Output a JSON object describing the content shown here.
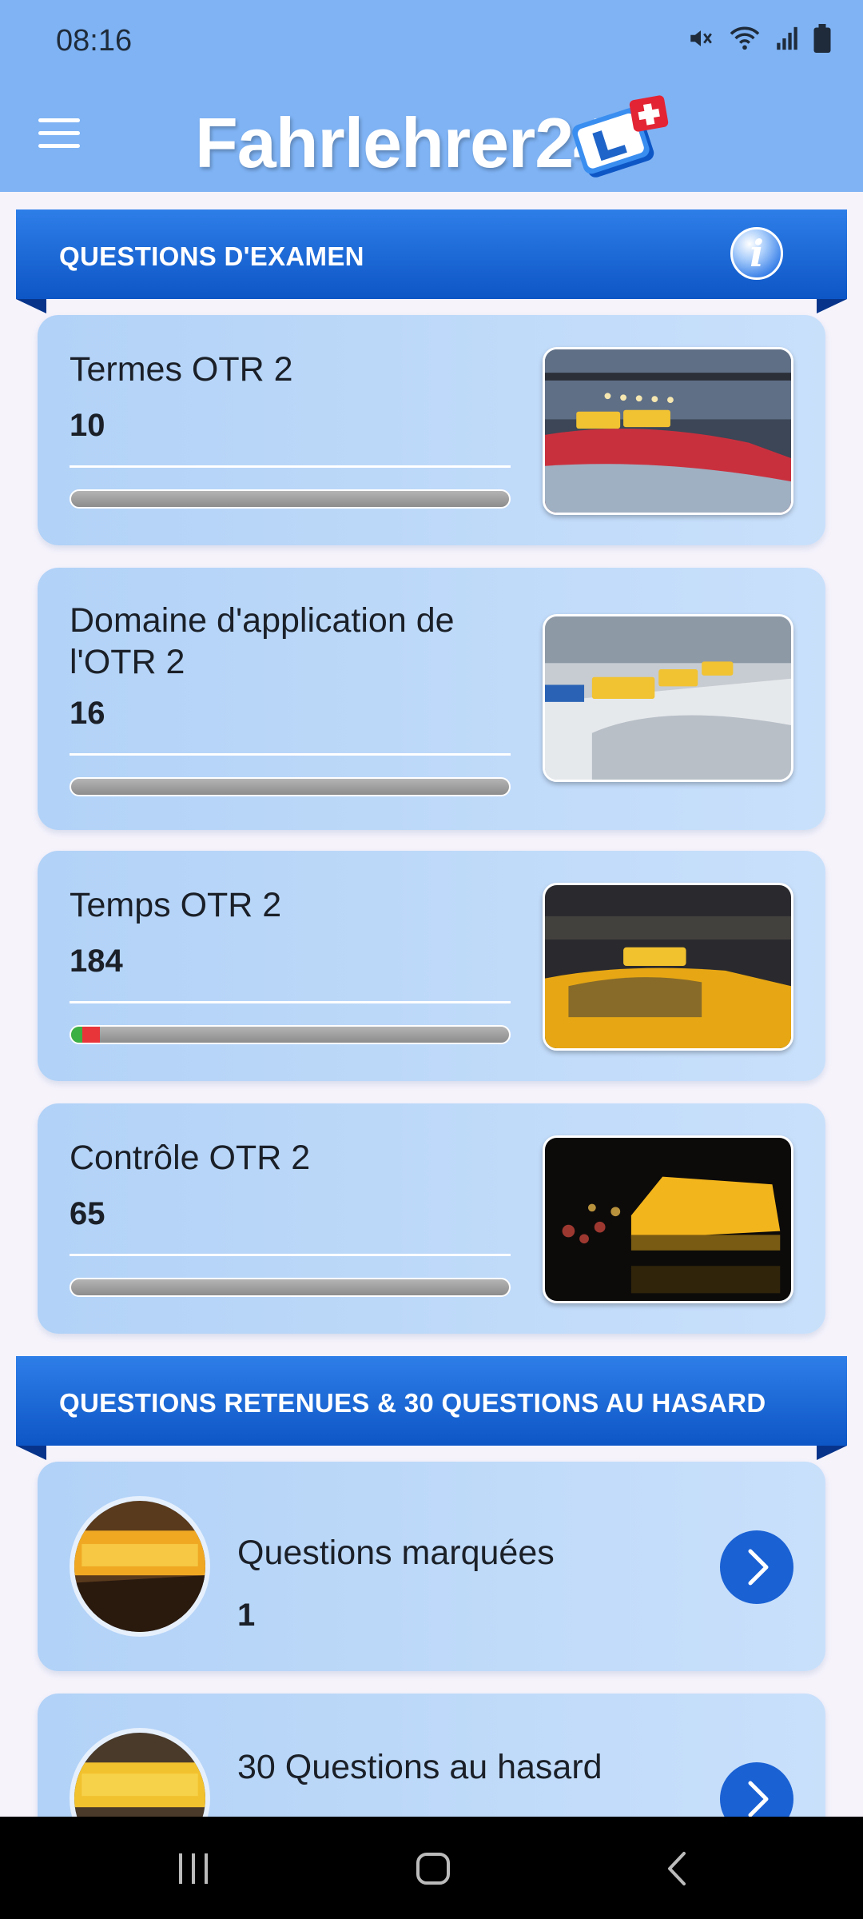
{
  "status_bar": {
    "time": "08:16",
    "icons": [
      "mute-icon",
      "wifi-icon",
      "signal-icon",
      "battery-icon"
    ]
  },
  "header": {
    "app_name": "Fahrlehrer24",
    "menu_icon": "hamburger-icon",
    "logo": "l-plate-swiss-logo"
  },
  "sections": {
    "exam": {
      "title": "QUESTIONS D'EXAMEN",
      "info_icon": "info-icon"
    },
    "saved": {
      "title": "QUESTIONS RETENUES & 30 QUESTIONS AU HASARD"
    }
  },
  "topics": [
    {
      "title": "Termes OTR 2",
      "count": "10",
      "progress_correct": 0,
      "progress_wrong": 0
    },
    {
      "title": "Domaine d'application de l'OTR 2",
      "count": "16",
      "progress_correct": 0,
      "progress_wrong": 0
    },
    {
      "title": "Temps OTR 2",
      "count": "184",
      "progress_correct": 0.025,
      "progress_wrong": 0.04
    },
    {
      "title": "Contrôle OTR 2",
      "count": "65",
      "progress_correct": 0,
      "progress_wrong": 0
    }
  ],
  "lists": [
    {
      "title": "Questions marquées",
      "count": "1"
    },
    {
      "title": "30 Questions au hasard",
      "count": ""
    }
  ],
  "colors": {
    "accent": "#1a61d4",
    "header_bg": "#7fb3f4",
    "card_bg": "#b8d6f8",
    "progress_correct": "#3cb043",
    "progress_wrong": "#e8353a"
  }
}
